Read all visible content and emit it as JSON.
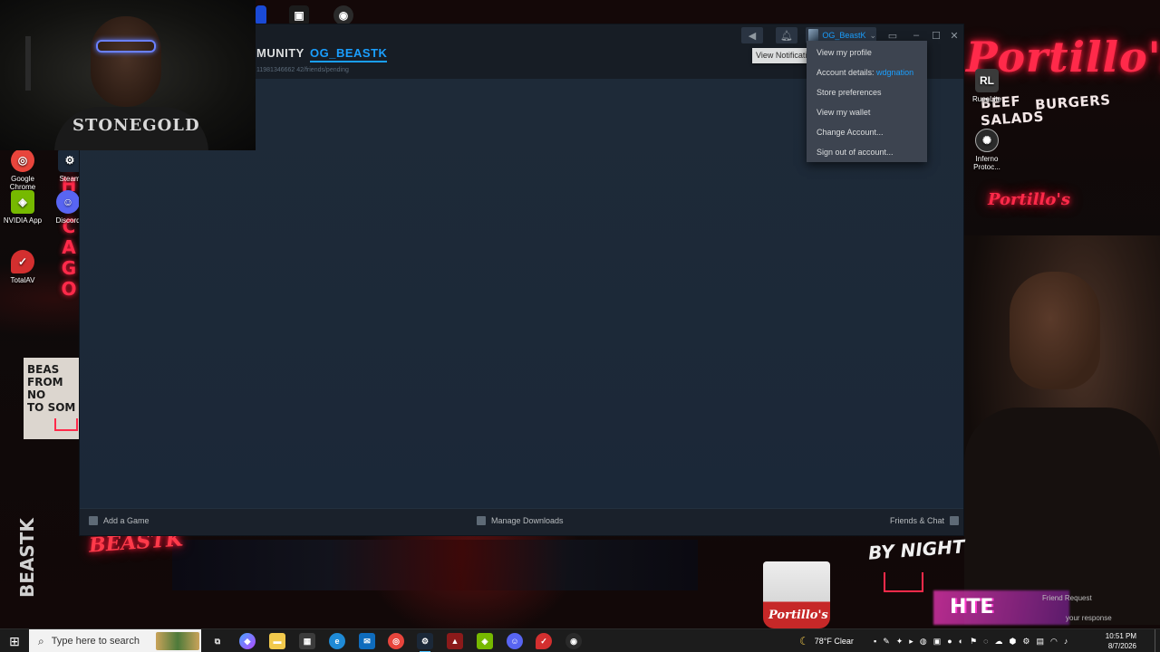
{
  "desktop": {
    "wallpaper": {
      "portillos_title": "Portillo's",
      "menu_words": [
        "BEEF",
        "BURGERS",
        "SALADS"
      ],
      "portillos_small": "Portillo's",
      "chicago": [
        "C",
        "H",
        "I",
        "C",
        "A",
        "G",
        "O"
      ],
      "sign_text": "BEAS\nFROM NO\nTO SOM",
      "beastk_bottom": "BEASTK",
      "beastk_vertical": "BEASTK",
      "by_night": "BY NIGHT",
      "cup_label": "Portillo's",
      "glitch_text": "HTE",
      "ghost_notif_1": "Friend Request",
      "ghost_notif_2": "your response"
    },
    "webcam": {
      "shirt_print": "STONEGOLD"
    },
    "icons_left": [
      {
        "label": "Google Chrome",
        "icon": "chrome-icon",
        "color": "#e8453c"
      },
      {
        "label": "Steam",
        "icon": "steam-icon",
        "color": "#1b2838"
      },
      {
        "label": "NVIDIA App",
        "icon": "nvidia-icon",
        "color": "#76b900"
      },
      {
        "label": "Discord",
        "icon": "discord-icon",
        "color": "#5865f2"
      },
      {
        "label": "TotalAV",
        "icon": "totalav-icon",
        "color": "#d32f2f"
      }
    ],
    "icons_right": [
      {
        "label": "RuneLite",
        "icon": "runelite-icon",
        "color": "#3a3a3a"
      },
      {
        "label": "Inferno Protoc...",
        "icon": "inferno-icon",
        "color": "#2a2a2a"
      }
    ]
  },
  "steam": {
    "nav": {
      "community": "MUNITY",
      "username": "OG_BEASTK",
      "url": "11981346662 42/friends/pending"
    },
    "titlebar": {
      "account_name": "OG_BeastK",
      "account_caret": "⌄",
      "icons": [
        "megaphone-icon",
        "bell-icon",
        "monitor-icon",
        "minimize-icon",
        "maximize-icon",
        "close-icon"
      ]
    },
    "tooltip": "View Notifications",
    "account_menu": {
      "items": [
        {
          "label": "View my profile"
        },
        {
          "label": "Account details: ",
          "highlight": "wdgnation"
        },
        {
          "label": "Store preferences"
        },
        {
          "label": "View my wallet"
        },
        {
          "label": "Change Account..."
        },
        {
          "label": "Sign out of account..."
        }
      ]
    },
    "bottom_bar": {
      "add_game": "Add a Game",
      "manage_downloads": "Manage Downloads",
      "friends_chat": "Friends & Chat"
    }
  },
  "taskbar": {
    "search_placeholder": "Type here to search",
    "weather": "78°F  Clear",
    "time": "10:51 PM",
    "date": "8/7/2026",
    "colors": {
      "accent": "#4cc2ff"
    }
  }
}
